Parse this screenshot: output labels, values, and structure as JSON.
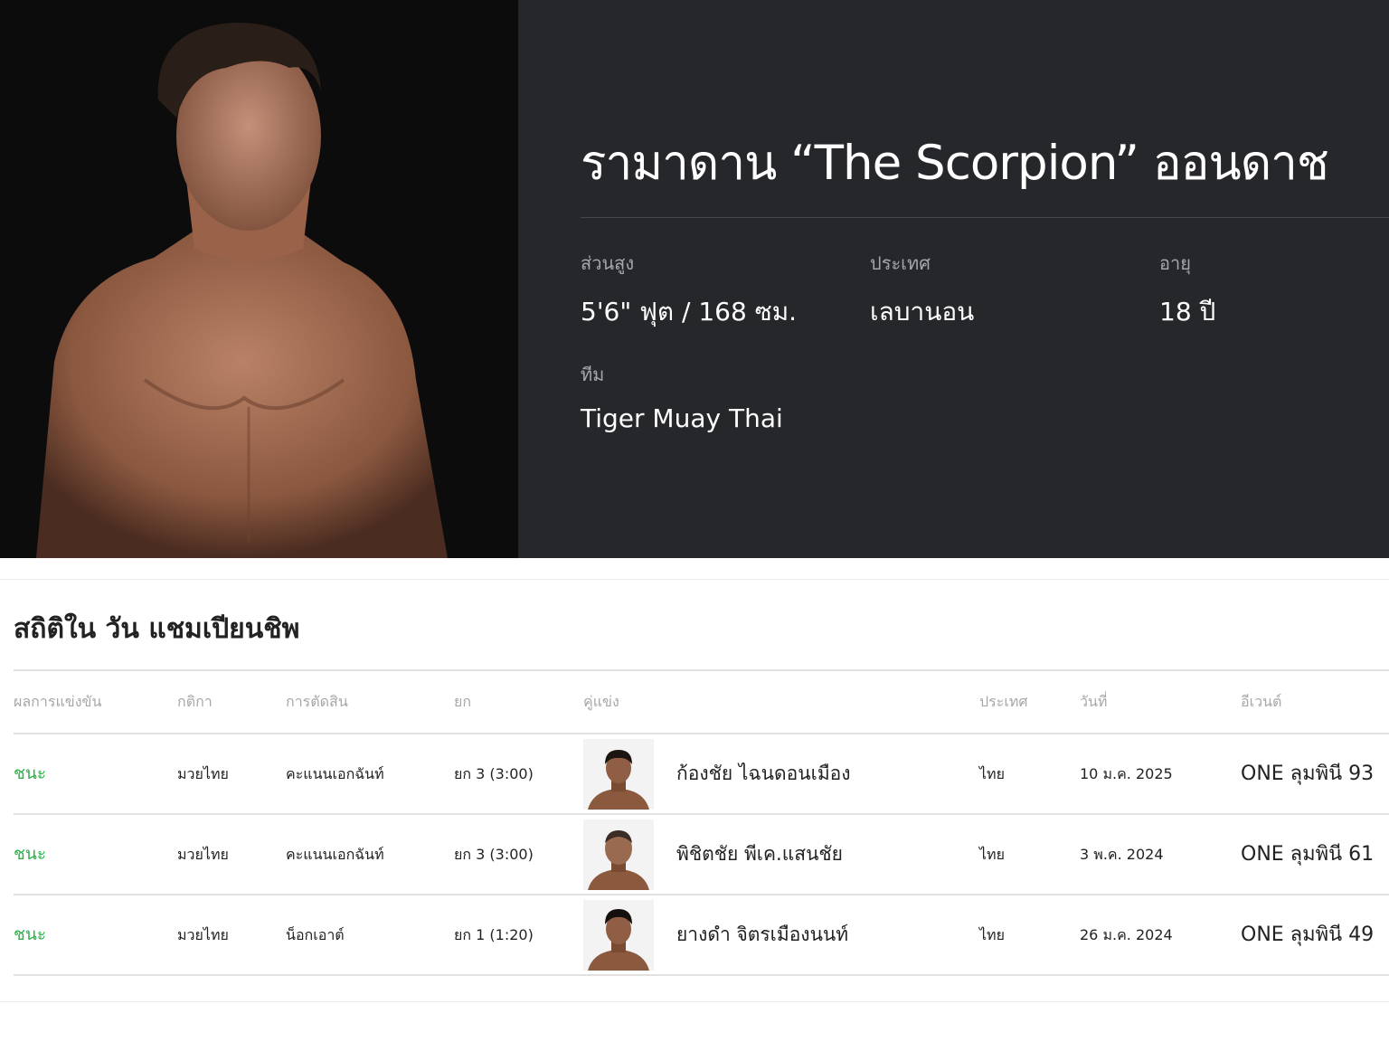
{
  "fighter": {
    "name": "รามาดาน “The Scorpion” ออนดาช",
    "height_label": "ส่วนสูง",
    "height_value": "5'6\" ฟุต / 168 ซม.",
    "country_label": "ประเทศ",
    "country_value": "เลบานอน",
    "age_label": "อายุ",
    "age_value": "18 ปี",
    "team_label": "ทีม",
    "team_value": "Tiger Muay Thai"
  },
  "record": {
    "title": "สถิติใน วัน แชมเปียนชิพ",
    "headers": {
      "result": "ผลการแข่งขัน",
      "rules": "กติกา",
      "method": "การตัดสิน",
      "round": "ยก",
      "opponent": "คู่แข่ง",
      "country": "ประเทศ",
      "date": "วันที่",
      "event": "อีเวนต์"
    },
    "rows": [
      {
        "result": "ชนะ",
        "rules": "มวยไทย",
        "method": "คะแนนเอกฉันท์",
        "round": "ยก 3 (3:00)",
        "opponent": "ก้องชัย ไฉนดอนเมือง",
        "country": "ไทย",
        "date": "10 ม.ค. 2025",
        "event": "ONE ลุมพินี 93"
      },
      {
        "result": "ชนะ",
        "rules": "มวยไทย",
        "method": "คะแนนเอกฉันท์",
        "round": "ยก 3 (3:00)",
        "opponent": "พิชิตชัย พีเค.แสนชัย",
        "country": "ไทย",
        "date": "3 พ.ค. 2024",
        "event": "ONE ลุมพินี 61"
      },
      {
        "result": "ชนะ",
        "rules": "มวยไทย",
        "method": "น็อกเอาต์",
        "round": "ยก 1 (1:20)",
        "opponent": "ยางดำ จิตรเมืองนนท์",
        "country": "ไทย",
        "date": "26 ม.ค. 2024",
        "event": "ONE ลุมพินี 49"
      }
    ]
  },
  "colors": {
    "hero_bg": "#26272b",
    "photo_bg": "#0c0c0d",
    "win": "#2db24a"
  }
}
